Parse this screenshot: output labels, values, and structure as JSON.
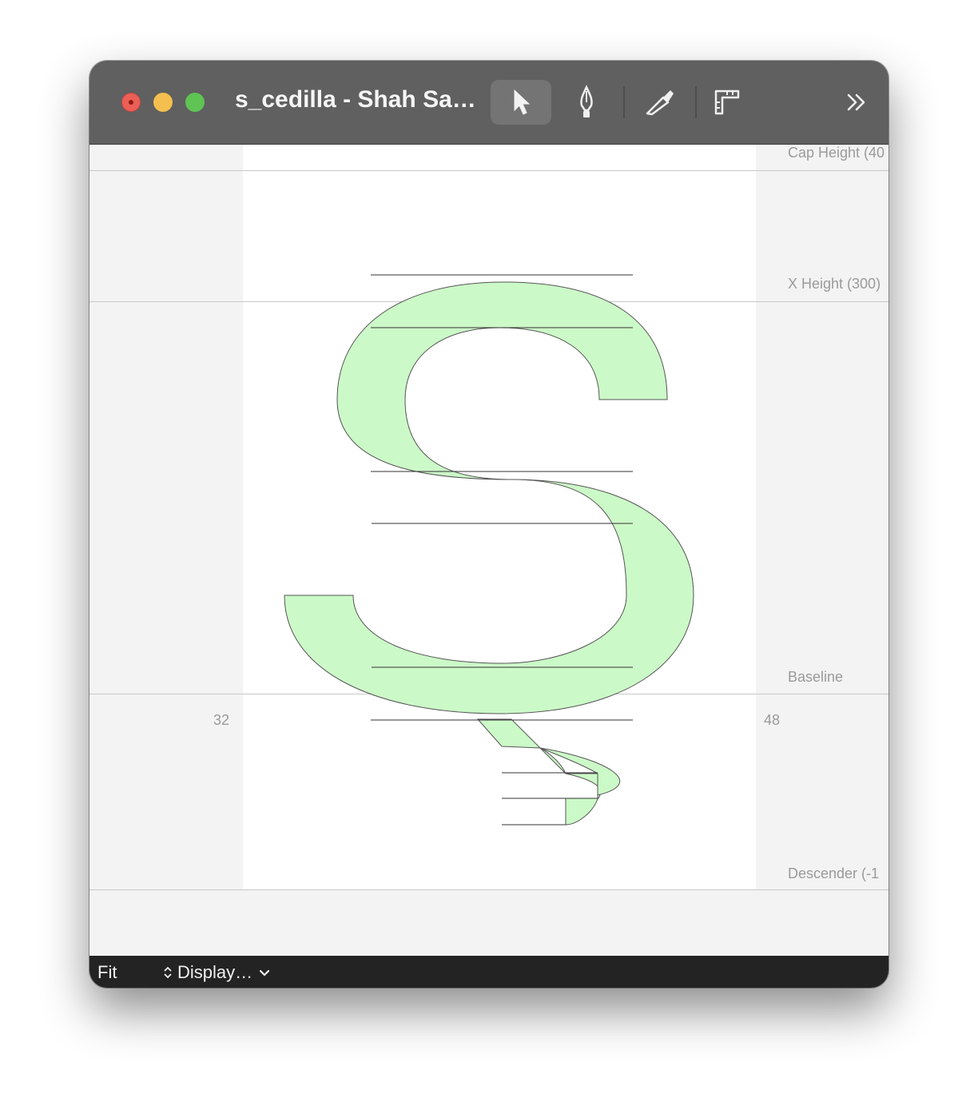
{
  "window": {
    "title": "s_cedilla - Shah Sa…",
    "traffic_lights": [
      "close",
      "minimize",
      "zoom"
    ]
  },
  "toolbar": {
    "tools": [
      {
        "name": "select",
        "icon": "arrow-cursor-icon",
        "active": true
      },
      {
        "name": "pen",
        "icon": "pen-nib-icon",
        "active": false
      },
      {
        "name": "knife",
        "icon": "knife-icon",
        "active": false
      },
      {
        "name": "measure",
        "icon": "ruler-icon",
        "active": false
      }
    ],
    "overflow_icon": "double-chevron-right-icon"
  },
  "metrics": {
    "cap_height_label": "Cap Height (40",
    "x_height_label": "X Height (300)",
    "baseline_label": "Baseline",
    "descender_label": "Descender (-1"
  },
  "sidebearings": {
    "left": "32",
    "right": "48"
  },
  "glyph": {
    "fill_color": "#ccf9c8",
    "stroke_color": "#555555"
  },
  "statusbar": {
    "zoom_label": "Fit",
    "display_label": "Display…"
  }
}
